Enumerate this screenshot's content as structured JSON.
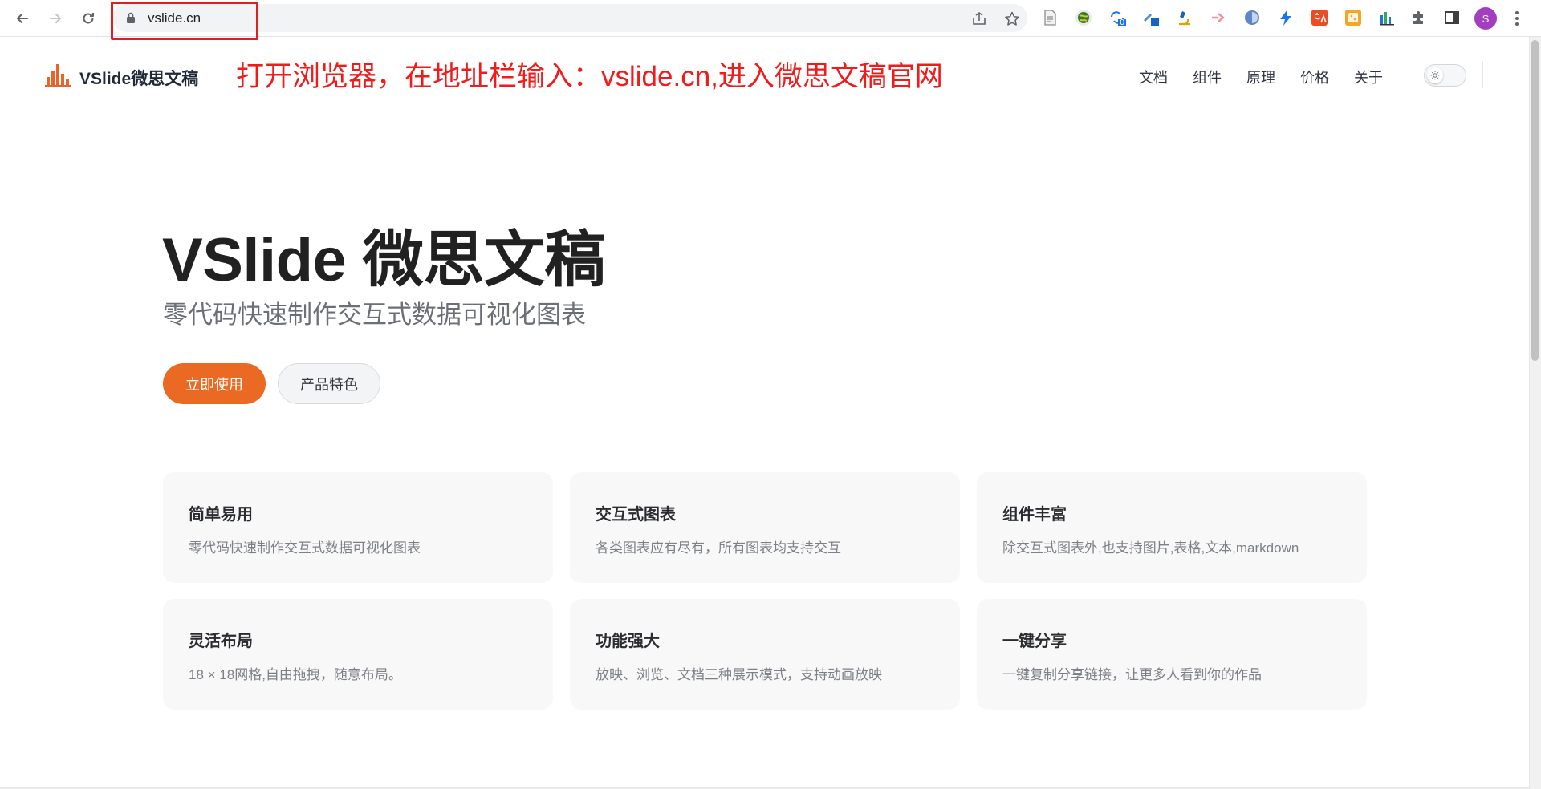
{
  "browser": {
    "url": "vslide.cn",
    "profile_initial": "S",
    "extension_badge": "0",
    "extensions": [
      "doc-icon",
      "globe-extension-icon",
      "sync-extension-icon",
      "pen-extension-icon",
      "microscope-extension-icon",
      "arrow-extension-icon",
      "circle-extension-icon",
      "lightning-extension-icon",
      "translate-extension-icon",
      "cookie-extension-icon",
      "chart-extension-icon",
      "puzzle-icon",
      "sidepanel-icon"
    ]
  },
  "site": {
    "logo_text": "VSlide微思文稿",
    "annotation": "打开浏览器，在地址栏输入：vslide.cn,进入微思文稿官网",
    "nav": [
      "文档",
      "组件",
      "原理",
      "价格",
      "关于"
    ]
  },
  "hero": {
    "title": "VSlide 微思文稿",
    "subtitle": "零代码快速制作交互式数据可视化图表",
    "primary_button": "立即使用",
    "secondary_button": "产品特色"
  },
  "features": [
    {
      "title": "简单易用",
      "desc": "零代码快速制作交互式数据可视化图表"
    },
    {
      "title": "交互式图表",
      "desc": "各类图表应有尽有，所有图表均支持交互"
    },
    {
      "title": "组件丰富",
      "desc": "除交互式图表外,也支持图片,表格,文本,markdown"
    },
    {
      "title": "灵活布局",
      "desc": "18 × 18网格,自由拖拽，随意布局。"
    },
    {
      "title": "功能强大",
      "desc": "放映、浏览、文档三种展示模式，支持动画放映"
    },
    {
      "title": "一键分享",
      "desc": "一键复制分享链接，让更多人看到你的作品"
    }
  ],
  "colors": {
    "accent": "#ea6a24",
    "annotation": "#f01b1b",
    "highlight_box": "#e02020",
    "avatar": "#a33fbf"
  }
}
